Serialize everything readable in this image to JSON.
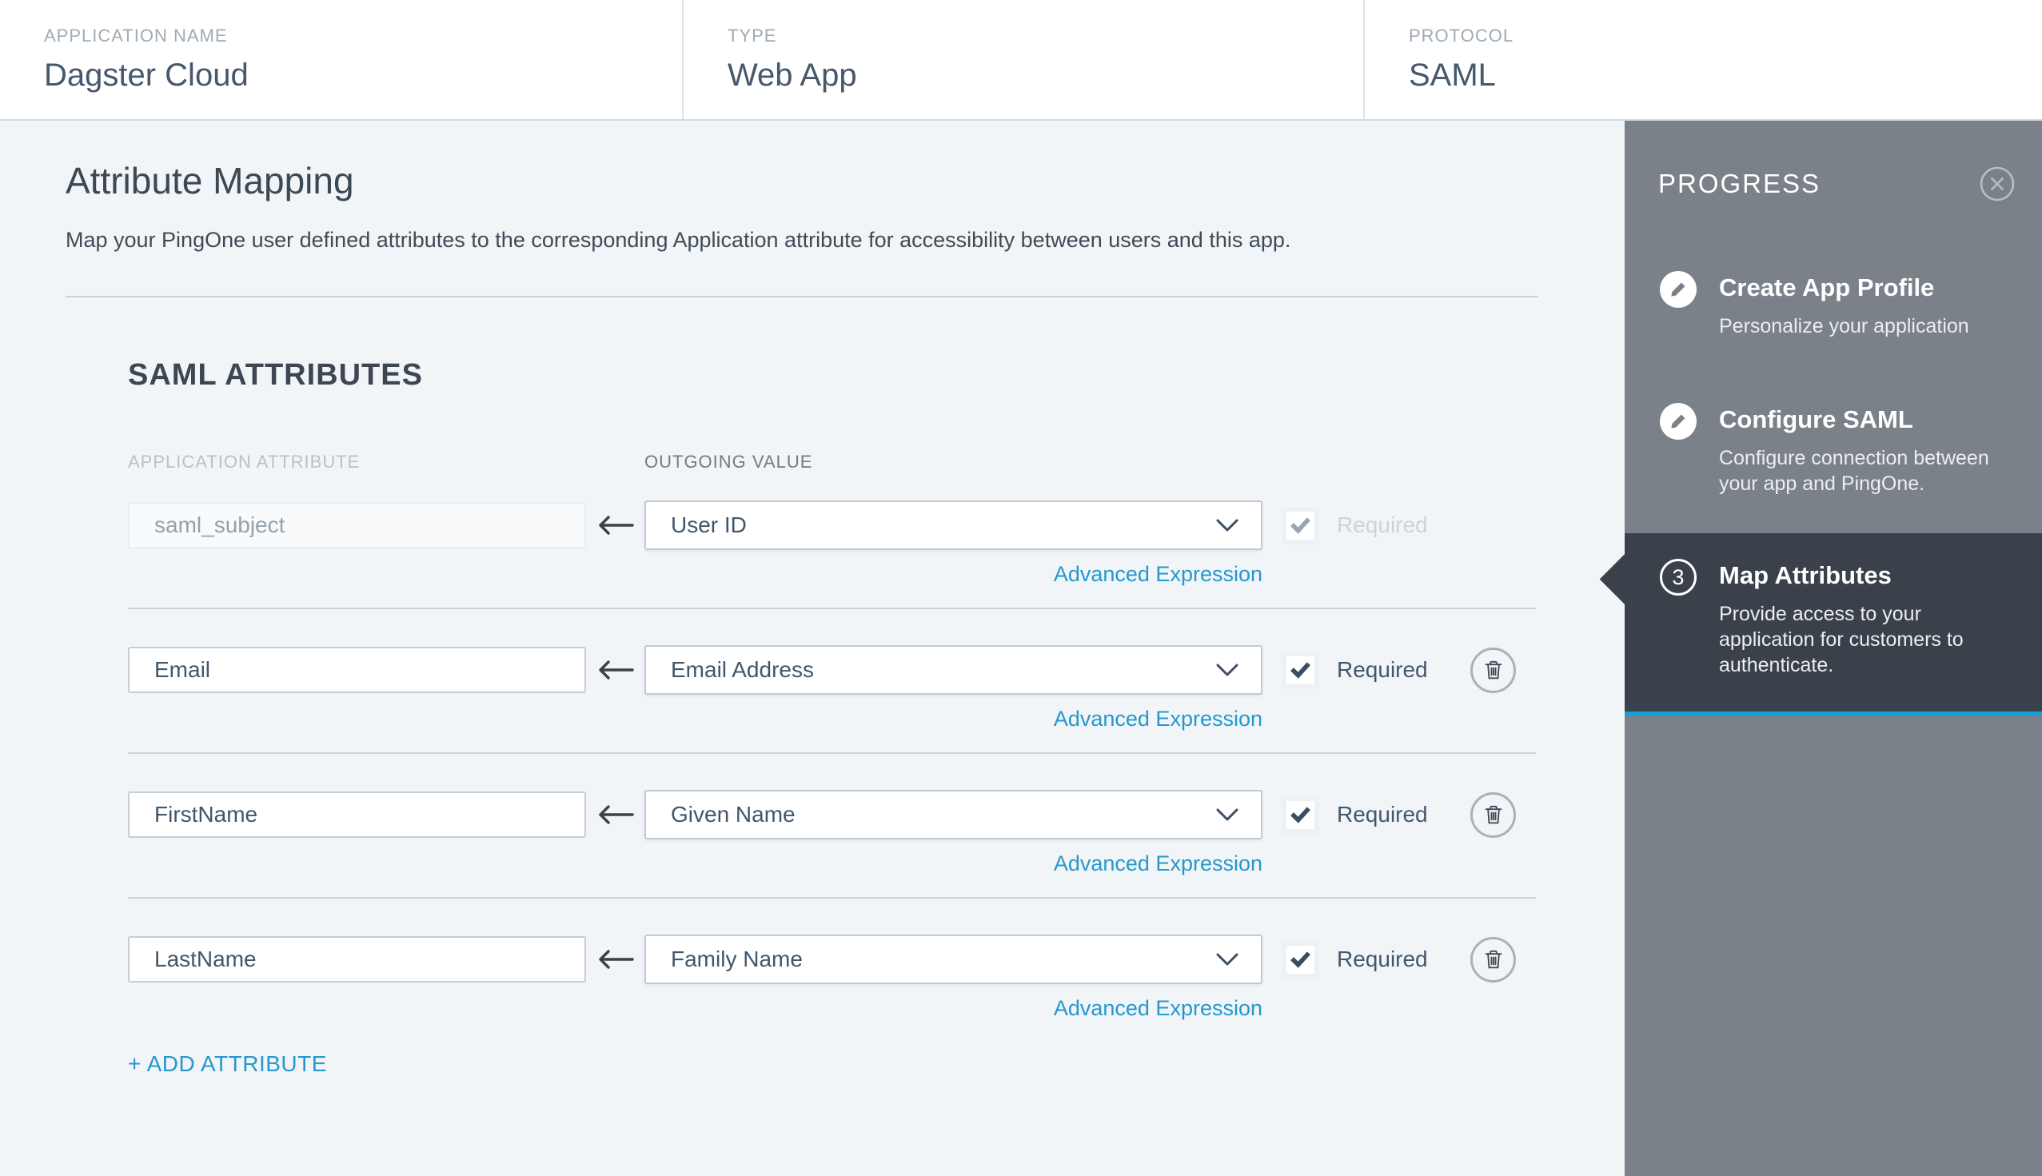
{
  "header": {
    "fields": [
      {
        "label": "APPLICATION NAME",
        "value": "Dagster Cloud"
      },
      {
        "label": "TYPE",
        "value": "Web App"
      },
      {
        "label": "PROTOCOL",
        "value": "SAML"
      }
    ]
  },
  "main": {
    "title": "Attribute Mapping",
    "description": "Map your PingOne user defined attributes to the corresponding Application attribute for accessibility between users and this app.",
    "section_title": "SAML ATTRIBUTES",
    "columns": {
      "application_attribute": "APPLICATION ATTRIBUTE",
      "outgoing_value": "OUTGOING VALUE"
    },
    "advanced_expression_label": "Advanced Expression",
    "required_label": "Required",
    "add_attribute_label": "+ ADD ATTRIBUTE",
    "rows": [
      {
        "application_attribute": "saml_subject",
        "outgoing_value": "User ID",
        "required": true,
        "disabled": true,
        "deletable": false
      },
      {
        "application_attribute": "Email",
        "outgoing_value": "Email Address",
        "required": true,
        "disabled": false,
        "deletable": true
      },
      {
        "application_attribute": "FirstName",
        "outgoing_value": "Given Name",
        "required": true,
        "disabled": false,
        "deletable": true
      },
      {
        "application_attribute": "LastName",
        "outgoing_value": "Family Name",
        "required": true,
        "disabled": false,
        "deletable": true
      }
    ]
  },
  "progress": {
    "title": "PROGRESS",
    "steps": [
      {
        "icon": "pencil-icon",
        "title": "Create App Profile",
        "description": "Personalize your application",
        "active": false
      },
      {
        "icon": "pencil-icon",
        "title": "Configure SAML",
        "description": "Configure connection between your app and PingOne.",
        "active": false
      },
      {
        "number": "3",
        "title": "Map Attributes",
        "description": "Provide access to your application for customers to authenticate.",
        "active": true
      }
    ]
  },
  "colors": {
    "accent_blue": "#14a0d8",
    "link_blue": "#2598cd",
    "sidebar_gray": "#7b8188",
    "active_step_bg": "#3a414a",
    "page_background": "#f1f5f8"
  }
}
